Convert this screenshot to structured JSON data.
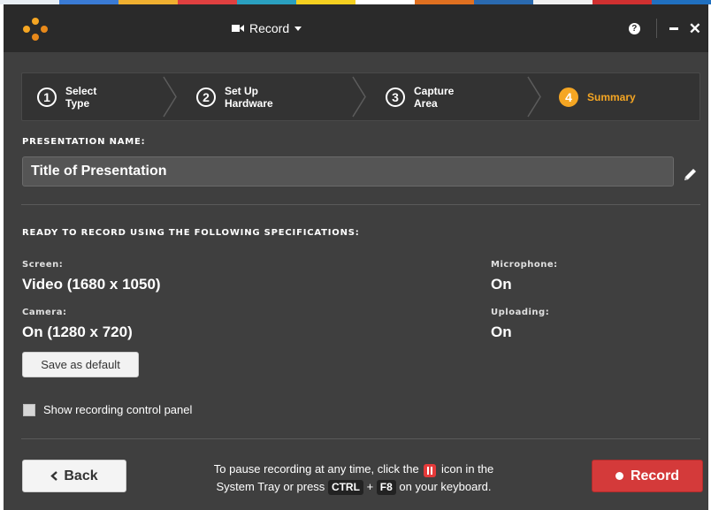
{
  "colors": {
    "accent": "#f5a623",
    "record": "#d43a3a",
    "panel": "#3f3f3f",
    "titlebar": "#2a2a2a"
  },
  "titlebar": {
    "menu_label": "Record",
    "help_icon": "?",
    "icons": [
      "logo-icon",
      "video-camera-icon",
      "caret-down-icon",
      "help-icon",
      "minimize-icon",
      "close-icon"
    ]
  },
  "steps": [
    {
      "number": "1",
      "line1": "Select",
      "line2": "Type",
      "active": false
    },
    {
      "number": "2",
      "line1": "Set Up",
      "line2": "Hardware",
      "active": false
    },
    {
      "number": "3",
      "line1": "Capture",
      "line2": "Area",
      "active": false
    },
    {
      "number": "4",
      "line1": "Summary",
      "line2": "",
      "active": true
    }
  ],
  "presentation": {
    "label": "PRESENTATION NAME:",
    "value": "Title of Presentation"
  },
  "specs": {
    "heading": "READY TO RECORD USING THE FOLLOWING SPECIFICATIONS:",
    "screen_label": "Screen:",
    "screen_value": "Video (1680 x 1050)",
    "camera_label": "Camera:",
    "camera_value": "On (1280 x 720)",
    "microphone_label": "Microphone:",
    "microphone_value": "On",
    "uploading_label": "Uploading:",
    "uploading_value": "On"
  },
  "save_default_label": "Save as default",
  "show_panel_label": "Show recording control panel",
  "footer": {
    "back_label": "Back",
    "hint_part1": "To pause recording at any time, click the",
    "hint_part2": "icon in the",
    "hint_part3": "System Tray or press",
    "key_ctrl": "CTRL",
    "plus": "+",
    "key_f8": "F8",
    "hint_part4": "on your keyboard.",
    "record_label": "Record"
  }
}
